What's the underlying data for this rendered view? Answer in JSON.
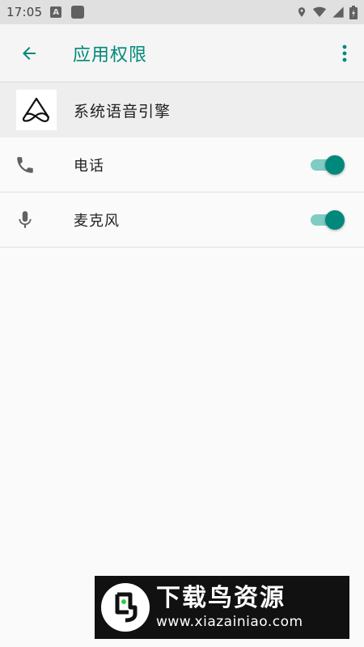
{
  "status_bar": {
    "time": "17:05",
    "notification_icons": [
      "a-letter-icon",
      "square-icon"
    ],
    "system_icons": [
      "location-icon",
      "wifi-icon",
      "signal-icon",
      "battery-icon"
    ]
  },
  "app_bar": {
    "title": "应用权限",
    "back_icon": "arrow-back-icon",
    "menu_icon": "more-vert-icon"
  },
  "app": {
    "name": "系统语音引擎",
    "logo_icon": "app-logo-icon"
  },
  "permissions": [
    {
      "icon": "phone-icon",
      "label": "电话",
      "enabled": true
    },
    {
      "icon": "mic-icon",
      "label": "麦克风",
      "enabled": true
    }
  ],
  "watermark": {
    "title": "下载鸟资源",
    "url": "www.xiazainiao.com"
  },
  "colors": {
    "accent": "#00897b",
    "accent_track": "#80cbc4",
    "status_bar_bg": "#e0e0e0",
    "app_bar_bg": "#f5f5f5",
    "header_bg": "#eeeeee",
    "page_bg": "#fafafa"
  }
}
